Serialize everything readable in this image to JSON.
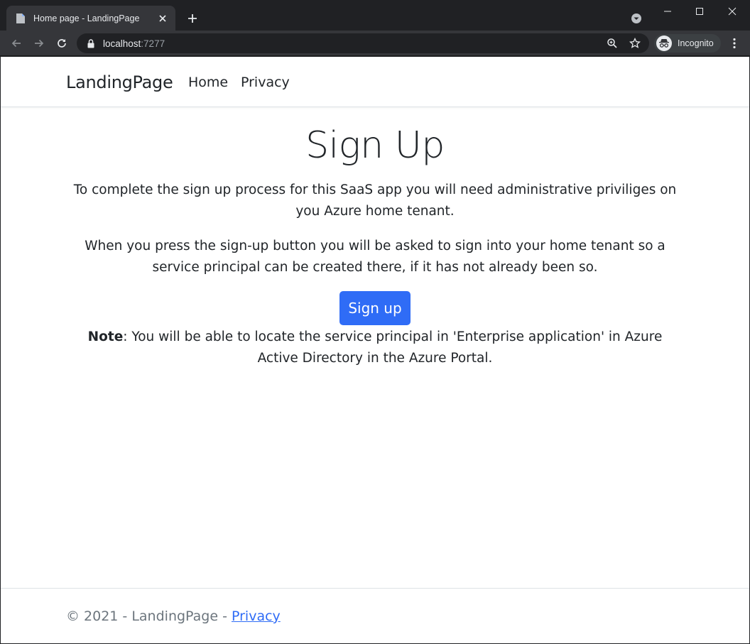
{
  "browser": {
    "tab_title": "Home page - LandingPage",
    "url_host": "localhost",
    "url_port": ":7277",
    "profile_label": "Incognito"
  },
  "navbar": {
    "brand": "LandingPage",
    "links": [
      "Home",
      "Privacy"
    ]
  },
  "main": {
    "heading": "Sign Up",
    "paragraph1": "To complete the sign up process for this SaaS app you will need administrative priviliges on you Azure home tenant.",
    "paragraph2": "When you press the sign-up button you will be asked to sign into your home tenant so a service principal can be created there, if it has not already been so.",
    "button_label": "Sign up",
    "note_label": "Note",
    "note_text": ": You will be able to locate the service principal in 'Enterprise application' in Azure Active Directory in the Azure Portal."
  },
  "footer": {
    "copyright": "© 2021 - LandingPage - ",
    "link": "Privacy"
  },
  "colors": {
    "primary": "#2f6cf6",
    "chrome_dark": "#202124",
    "chrome_toolbar": "#35363a"
  },
  "icons": [
    "page-icon",
    "close-icon",
    "plus-icon",
    "tab-search-icon",
    "minimize-icon",
    "maximize-icon",
    "window-close-icon",
    "back-arrow-icon",
    "forward-arrow-icon",
    "reload-icon",
    "lock-icon",
    "zoom-icon",
    "star-icon",
    "incognito-icon",
    "kebab-menu-icon"
  ]
}
